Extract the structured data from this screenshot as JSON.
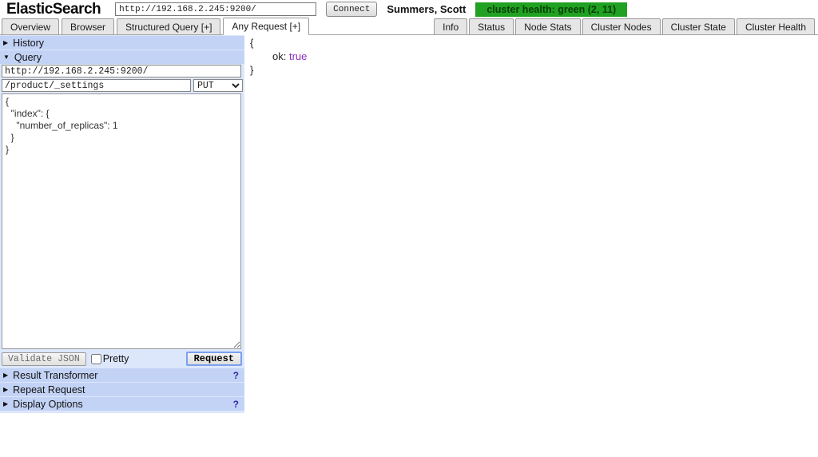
{
  "header": {
    "logo": "ElasticSearch",
    "base_url_value": "http://192.168.2.245:9200/",
    "connect_label": "Connect",
    "user": "Summers, Scott",
    "cluster_health": "cluster health: green (2, 11)"
  },
  "tabs": {
    "left": [
      "Overview",
      "Browser",
      "Structured Query [+]",
      "Any Request [+]"
    ],
    "active": "Any Request [+]",
    "right": [
      "Info",
      "Status",
      "Node Stats",
      "Cluster Nodes",
      "Cluster State",
      "Cluster Health"
    ]
  },
  "query_panel": {
    "sections": {
      "history": "History",
      "query": "Query",
      "result_transformer": "Result Transformer",
      "repeat_request": "Repeat Request",
      "display_options": "Display Options"
    },
    "query_url_value": "http://192.168.2.245:9200/",
    "path_value": "/product/_settings",
    "method_selected": "PUT",
    "body_value": "{\n  \"index\": {\n    \"number_of_replicas\": 1\n  }\n}",
    "validate_label": "Validate JSON",
    "pretty_label": "Pretty",
    "pretty_checked": false,
    "request_label": "Request"
  },
  "output": {
    "open_brace": "{",
    "field_key": "ok:",
    "field_value": "true",
    "close_brace": "}"
  },
  "icons": {
    "collapsed_arrow": "▶",
    "expanded_arrow": "▼",
    "help": "?"
  },
  "colors": {
    "health_badge_bg": "#21a121",
    "health_badge_text": "#073f07",
    "panel_bg": "#dce7fb",
    "section_header_bg": "#c3d3f6",
    "boolean_value": "#8a2fbe",
    "tab_border": "#999999"
  }
}
